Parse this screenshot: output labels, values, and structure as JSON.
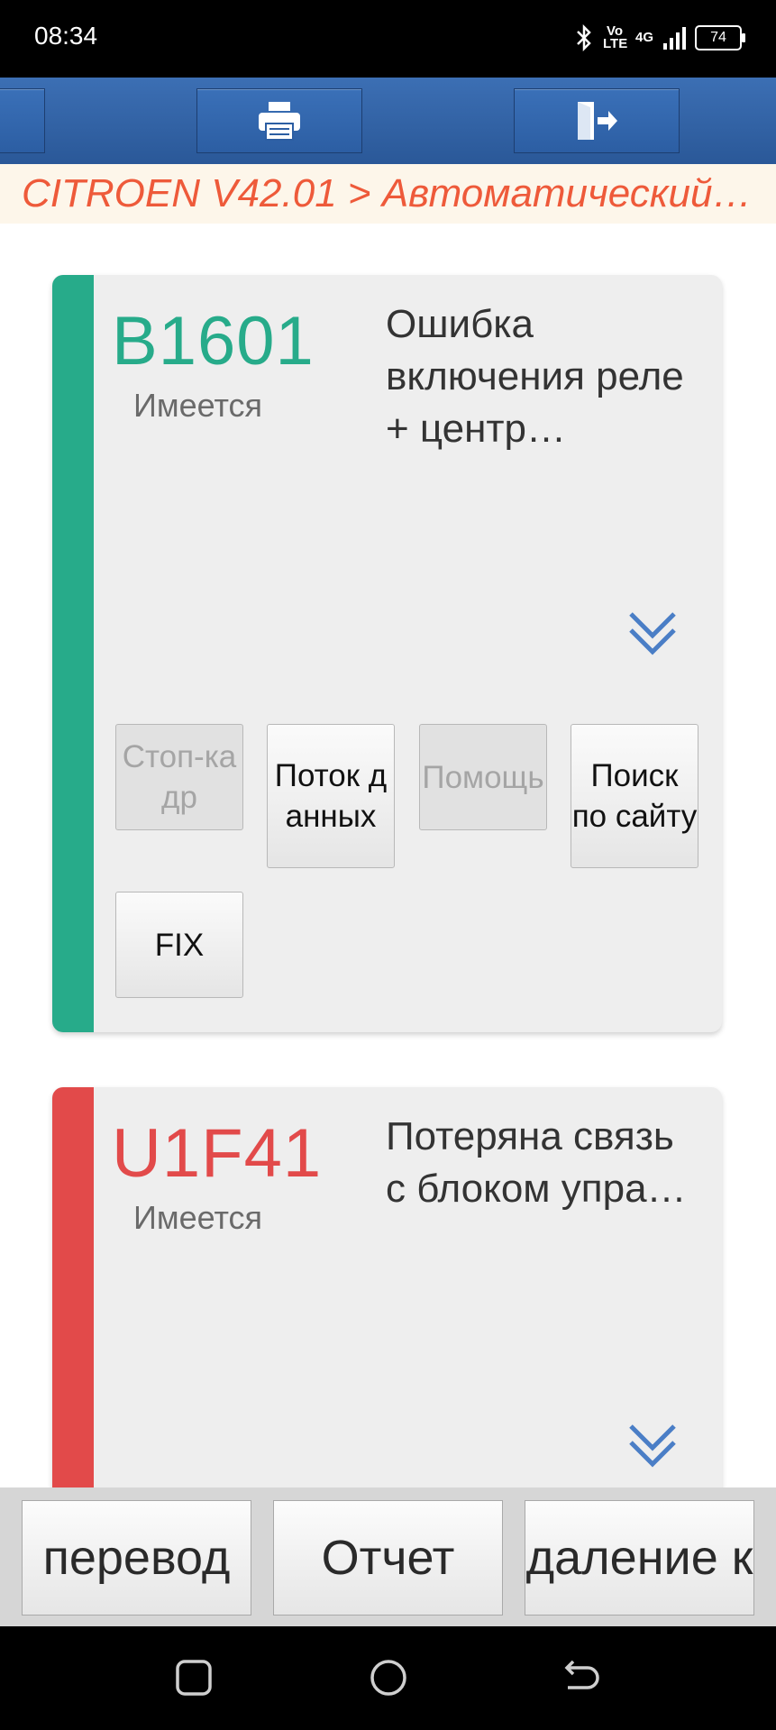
{
  "status_bar": {
    "time": "08:34",
    "volte": "Vo LTE",
    "network": "4G",
    "battery": "74"
  },
  "toolbar": {
    "left_icon": "menu-icon",
    "print_icon": "printer-icon",
    "exit_icon": "exit-icon"
  },
  "breadcrumb": "CITROEN V42.01 > Автоматический…",
  "cards": [
    {
      "code": "B1601",
      "status": "Имеется",
      "description": "Ошибка включения реле + центр…",
      "color": "#27ab8a",
      "buttons": [
        "Стоп-кадр",
        "Поток данных",
        "Помощь",
        "Поиск по сайту",
        "FIX"
      ]
    },
    {
      "code": "U1F41",
      "status": "Имеется",
      "description": "Потеряна связь с блоком упра…",
      "color": "#e24a4a"
    }
  ],
  "bottom": {
    "translate": "перевод",
    "report": "Отчет",
    "delete": "даление к"
  }
}
